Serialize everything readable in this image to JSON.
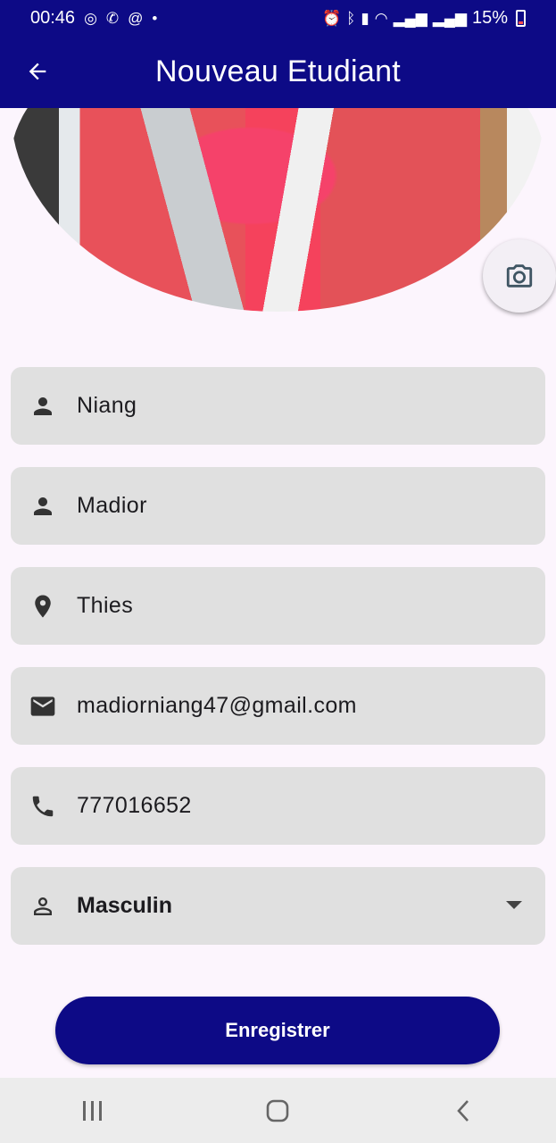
{
  "status_bar": {
    "time": "00:46",
    "battery_percent": "15%"
  },
  "app_bar": {
    "title": "Nouveau Etudiant"
  },
  "form": {
    "last_name": "Niang",
    "first_name": "Madior",
    "city": "Thies",
    "email": "madiorniang47@gmail.com",
    "phone": "777016652",
    "gender": "Masculin"
  },
  "actions": {
    "save_label": "Enregistrer"
  },
  "colors": {
    "primary": "#0d0a86",
    "background": "#fcf5fd",
    "field_fill": "#e0e0e0"
  },
  "icons": [
    "arrow-back-icon",
    "camera-icon",
    "person-icon",
    "location-pin-icon",
    "email-icon",
    "phone-icon",
    "person-outline-icon",
    "dropdown-arrow-icon",
    "recents-icon",
    "home-icon",
    "nav-back-icon"
  ]
}
